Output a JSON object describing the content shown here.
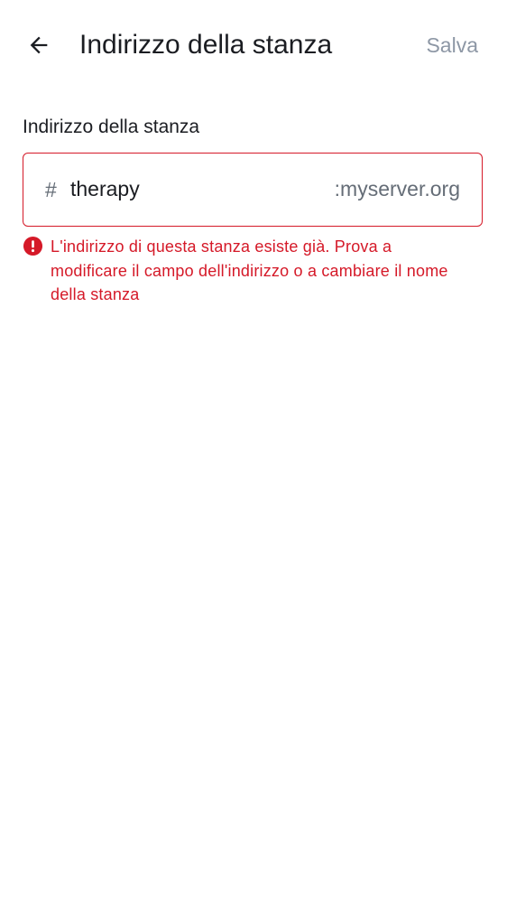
{
  "header": {
    "back_icon": "arrow-left-icon",
    "title": "Indirizzo della stanza",
    "save_label": "Salva"
  },
  "form": {
    "label": "Indirizzo della stanza",
    "prefix": "#",
    "value": "therapy",
    "suffix": ":myserver.org",
    "error_icon": "error-circle-icon",
    "error_message": "L'indirizzo di questa stanza esiste già. Prova a modificare il campo dell'indirizzo o a cambiare il nome della stanza"
  },
  "colors": {
    "error": "#d51928",
    "text_primary": "#1b1d22",
    "text_secondary": "#656d77",
    "disabled": "#8d97a5"
  }
}
